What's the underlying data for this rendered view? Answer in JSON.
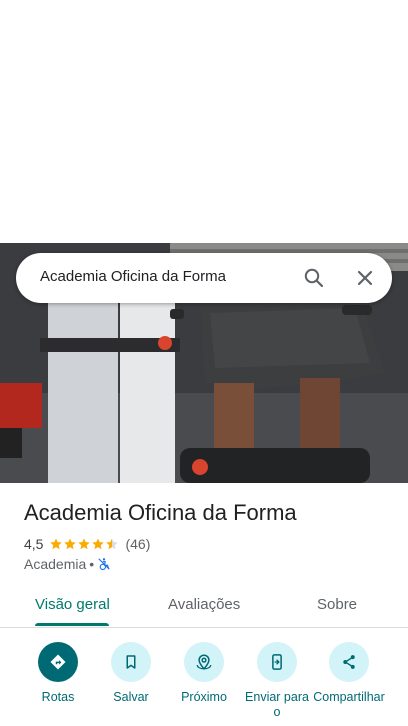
{
  "search": {
    "query": "Academia Oficina da Forma"
  },
  "place": {
    "name": "Academia Oficina da Forma",
    "rating": "4,5",
    "stars": 4.5,
    "reviews": "(46)",
    "category": "Academia",
    "separator": "•"
  },
  "tabs": [
    {
      "label": "Visão geral",
      "active": true
    },
    {
      "label": "Avaliações",
      "active": false
    },
    {
      "label": "Sobre",
      "active": false
    }
  ],
  "actions": [
    {
      "label": "Rotas",
      "icon": "directions-icon"
    },
    {
      "label": "Salvar",
      "icon": "bookmark-icon"
    },
    {
      "label": "Próximo",
      "icon": "nearby-icon"
    },
    {
      "label": "Enviar para o",
      "icon": "send-to-phone-icon"
    },
    {
      "label": "Compartilhar",
      "icon": "share-icon"
    }
  ],
  "colors": {
    "accent": "#00796b",
    "action_bg": "#d2f3f8",
    "primary_action": "#006a74",
    "star": "#f9ab00"
  }
}
